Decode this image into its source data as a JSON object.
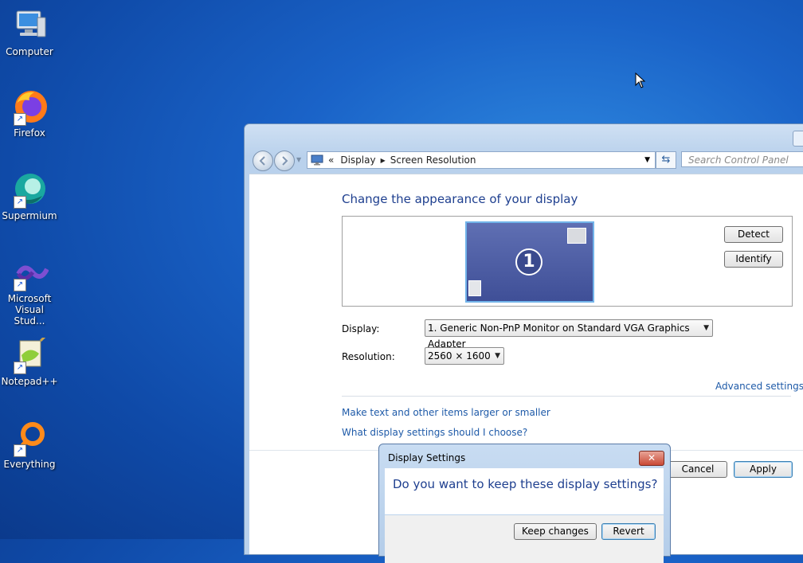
{
  "desktop": {
    "icons": [
      {
        "name": "computer",
        "label_line1": "Computer",
        "label_line2": ""
      },
      {
        "name": "firefox",
        "label_line1": "Firefox",
        "label_line2": ""
      },
      {
        "name": "supermium",
        "label_line1": "Supermium",
        "label_line2": ""
      },
      {
        "name": "visual-studio",
        "label_line1": "Microsoft",
        "label_line2": "Visual Stud..."
      },
      {
        "name": "notepadpp",
        "label_line1": "Notepad++",
        "label_line2": ""
      },
      {
        "name": "everything",
        "label_line1": "Everything",
        "label_line2": ""
      }
    ]
  },
  "window": {
    "breadcrumb": {
      "sep": "«",
      "item1": "Display",
      "item2": "Screen Resolution"
    },
    "search_placeholder": "Search Control Panel",
    "heading": "Change the appearance of your display",
    "monitor_number": "1",
    "detect_label": "Detect",
    "identify_label": "Identify",
    "display_label": "Display:",
    "display_value": "1. Generic Non-PnP Monitor on Standard VGA Graphics Adapter",
    "resolution_label": "Resolution:",
    "resolution_value": "2560 × 1600",
    "advanced_link": "Advanced settings",
    "link_text_size": "Make text and other items larger or smaller",
    "link_which_settings": "What display settings should I choose?",
    "cancel_label": "Cancel",
    "apply_label": "Apply"
  },
  "dialog": {
    "title": "Display Settings",
    "close_glyph": "✕",
    "message": "Do you want to keep these display settings?",
    "keep_label": "Keep changes",
    "revert_label": "Revert"
  },
  "colors": {
    "heading": "#1e3f8f",
    "link": "#1e5aa8",
    "desktop": "#1a63c8"
  }
}
